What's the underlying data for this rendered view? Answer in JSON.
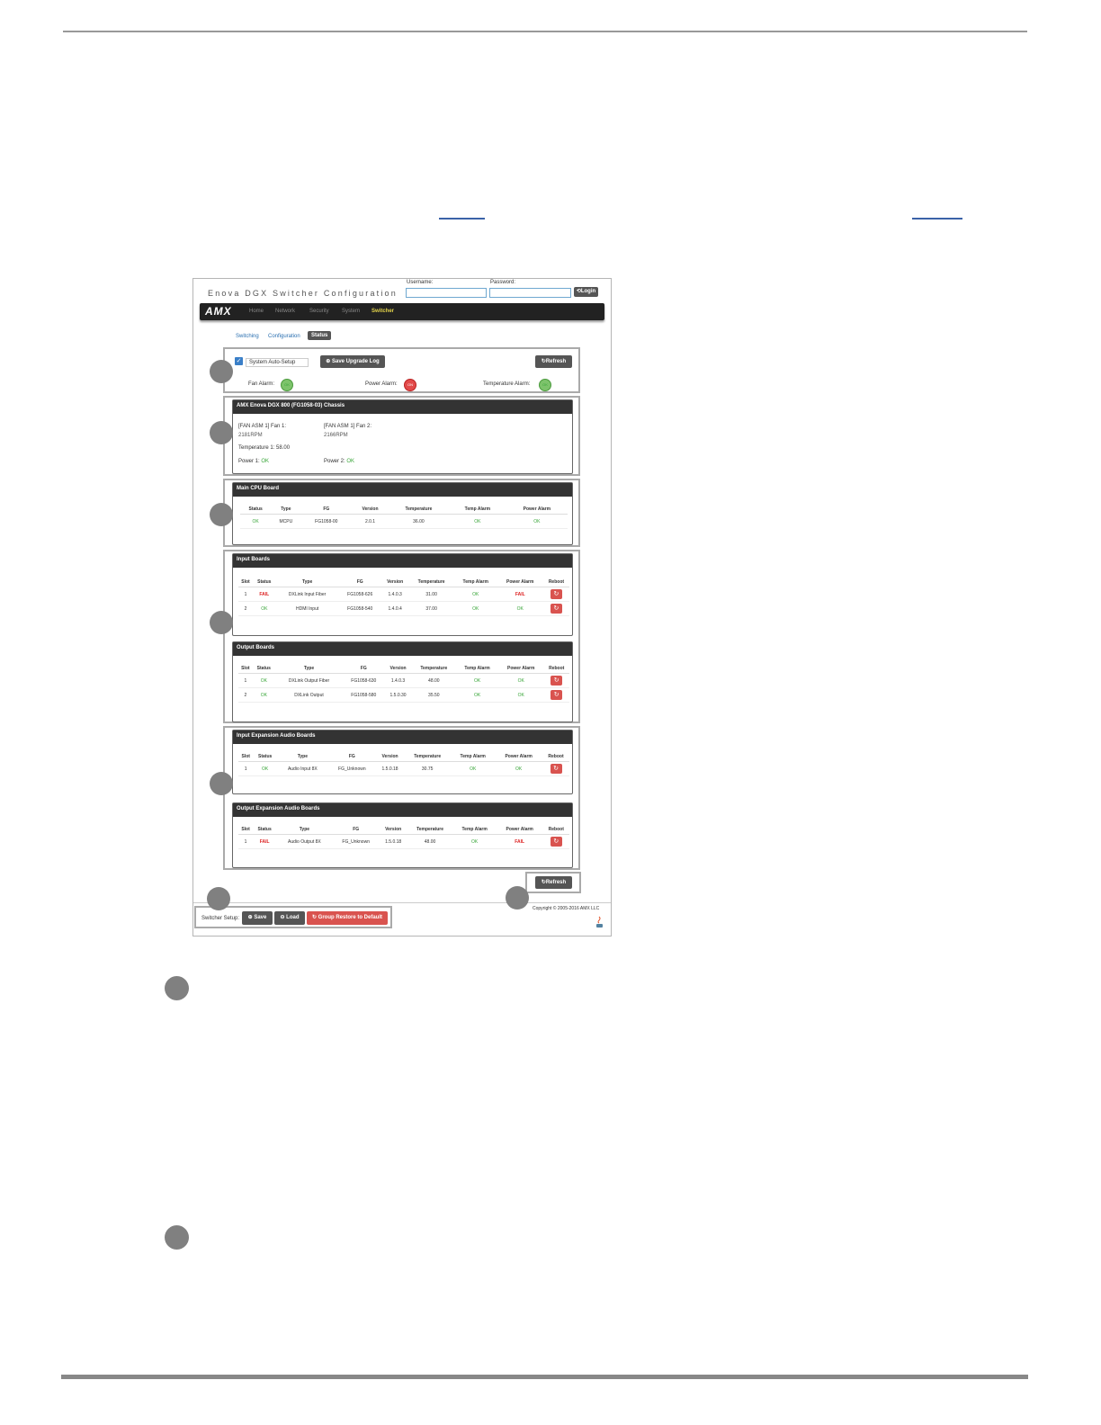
{
  "app": {
    "title": "Enova DGX Switcher Configuration",
    "username_label": "Username:",
    "password_label": "Password:",
    "login_label": "Login"
  },
  "nav": {
    "logo": "AMX",
    "items": [
      "Home",
      "Network",
      "Security",
      "System",
      "Switcher"
    ],
    "active": "Switcher"
  },
  "subtabs": [
    "Switching",
    "Configuration",
    "Status"
  ],
  "system": {
    "auto_setup_label": "System Auto-Setup",
    "save_log_label": "Save Upgrade Log",
    "refresh_label": "Refresh",
    "fan_alarm_label": "Fan Alarm:",
    "power_alarm_label": "Power Alarm:",
    "temp_alarm_label": "Temperature Alarm:",
    "fan_alarm_value": "OK",
    "power_alarm_value": "ON",
    "temp_alarm_value": "OK"
  },
  "chassis": {
    "title": "AMX Enova DGX 800 (FG1058-03) Chassis",
    "fan1_label": "[FAN ASM 1] Fan 1:",
    "fan1_value": "2181RPM",
    "fan2_label": "[FAN ASM 1] Fan 2:",
    "fan2_value": "2166RPM",
    "temperature": "Temperature 1: 58.00",
    "power1_label": "Power 1:",
    "power1_value": "OK",
    "power2_label": "Power 2:",
    "power2_value": "OK"
  },
  "cpu_board": {
    "title": "Main CPU Board",
    "headers": [
      "Status",
      "Type",
      "FG",
      "Version",
      "Temperature",
      "Temp Alarm",
      "Power Alarm"
    ],
    "rows": [
      [
        "OK",
        "MCPU",
        "FG1058-00",
        "2.0.1",
        "36.00",
        "OK",
        "OK"
      ]
    ]
  },
  "input_boards": {
    "title": "Input Boards",
    "headers": [
      "Slot",
      "Status",
      "Type",
      "FG",
      "Version",
      "Temperature",
      "Temp Alarm",
      "Power Alarm",
      "Reboot"
    ],
    "rows": [
      [
        "1",
        "FAIL",
        "DXLink Input Fiber",
        "FG1058-626",
        "1.4.0.3",
        "31.00",
        "OK",
        "FAIL"
      ],
      [
        "2",
        "OK",
        "HDMI Input",
        "FG1058-540",
        "1.4.0.4",
        "37.00",
        "OK",
        "OK"
      ]
    ]
  },
  "output_boards": {
    "title": "Output Boards",
    "headers": [
      "Slot",
      "Status",
      "Type",
      "FG",
      "Version",
      "Temperature",
      "Temp Alarm",
      "Power Alarm",
      "Reboot"
    ],
    "rows": [
      [
        "1",
        "OK",
        "DXLink Output Fiber",
        "FG1058-630",
        "1.4.0.3",
        "48.00",
        "OK",
        "OK"
      ],
      [
        "2",
        "OK",
        "DXLink Output",
        "FG1058-580",
        "1.5.0.30",
        "35.50",
        "OK",
        "OK"
      ]
    ]
  },
  "input_audio": {
    "title": "Input Expansion Audio Boards",
    "headers": [
      "Slot",
      "Status",
      "Type",
      "FG",
      "Version",
      "Temperature",
      "Temp Alarm",
      "Power Alarm",
      "Reboot"
    ],
    "rows": [
      [
        "1",
        "OK",
        "Audio Input 8X",
        "FG_Unknown",
        "1.5.0.18",
        "30.75",
        "OK",
        "OK"
      ]
    ]
  },
  "output_audio": {
    "title": "Output Expansion Audio Boards",
    "headers": [
      "Slot",
      "Status",
      "Type",
      "FG",
      "Version",
      "Temperature",
      "Temp Alarm",
      "Power Alarm",
      "Reboot"
    ],
    "rows": [
      [
        "1",
        "FAIL",
        "Audio Output 8X",
        "FG_Unknown",
        "1.5.0.18",
        "48.00",
        "OK",
        "FAIL"
      ]
    ]
  },
  "footer": {
    "refresh_label": "Refresh",
    "setup_label": "Switcher Setup:",
    "save_label": "Save",
    "load_label": "Load",
    "restore_label": "Group Restore to Default",
    "copyright": "Copyright © 2005-2016 AMX LLC"
  }
}
